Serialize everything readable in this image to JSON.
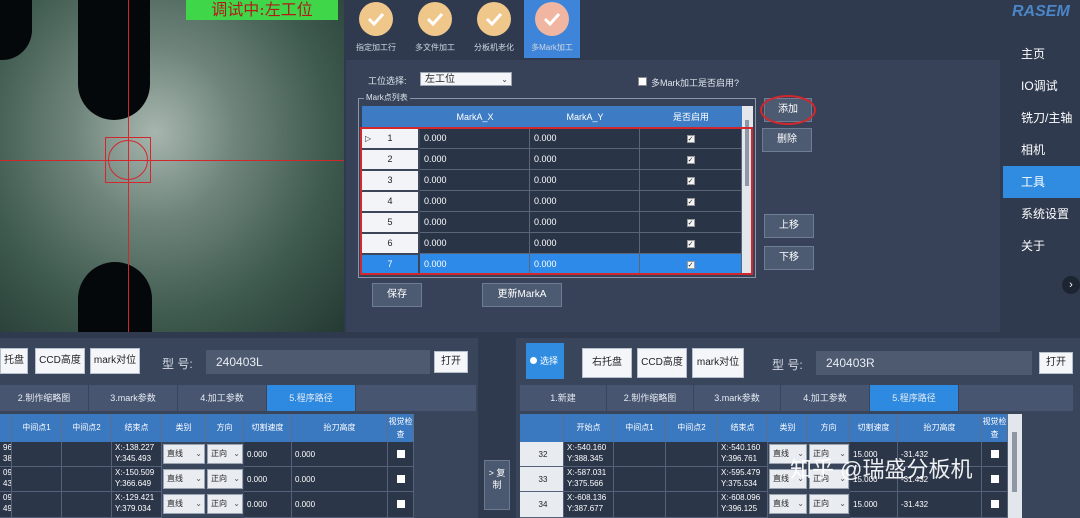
{
  "camera": {
    "status_banner": "调试中:左工位"
  },
  "toolbar": {
    "items": [
      {
        "label": "指定加工行",
        "active": false
      },
      {
        "label": "多文件加工",
        "active": false
      },
      {
        "label": "分板机老化",
        "active": false
      },
      {
        "label": "多Mark加工",
        "active": true
      }
    ]
  },
  "logo": "RASEM",
  "nav": {
    "items": [
      {
        "label": "主页",
        "active": false
      },
      {
        "label": "IO调试",
        "active": false
      },
      {
        "label": "铣刀/主轴",
        "active": false
      },
      {
        "label": "相机",
        "active": false
      },
      {
        "label": "工具",
        "active": true
      },
      {
        "label": "系统设置",
        "active": false
      },
      {
        "label": "关于",
        "active": false
      }
    ]
  },
  "mark_panel": {
    "station_label": "工位选择:",
    "station_value": "左工位",
    "enable_checkbox_label": "多Mark加工是否启用?",
    "list_group_title": "Mark点列表",
    "columns": [
      "MarkA_X",
      "MarkA_Y",
      "是否启用"
    ],
    "rows": [
      {
        "num": "1",
        "x": "0.000",
        "y": "0.000",
        "enabled": true
      },
      {
        "num": "2",
        "x": "0.000",
        "y": "0.000",
        "enabled": true
      },
      {
        "num": "3",
        "x": "0.000",
        "y": "0.000",
        "enabled": true
      },
      {
        "num": "4",
        "x": "0.000",
        "y": "0.000",
        "enabled": true
      },
      {
        "num": "5",
        "x": "0.000",
        "y": "0.000",
        "enabled": true
      },
      {
        "num": "6",
        "x": "0.000",
        "y": "0.000",
        "enabled": true
      },
      {
        "num": "7",
        "x": "0.000",
        "y": "0.000",
        "enabled": true
      }
    ],
    "buttons": {
      "add": "添加",
      "delete": "删除",
      "move_up": "上移",
      "move_down": "下移",
      "save": "保存",
      "update_mark": "更新MarkA"
    }
  },
  "left_panel": {
    "buttons": {
      "tray": "托盘",
      "ccd_height": "CCD高度",
      "mark_align": "mark对位",
      "open": "打开"
    },
    "model_label": "型  号:",
    "model_value": "240403L",
    "tabs": [
      "2.制作缩略图",
      "3.mark参数",
      "4.加工参数",
      "5.程序路径"
    ],
    "active_tab": 3,
    "columns": [
      "中间点1",
      "中间点2",
      "结束点",
      "类别",
      "方向",
      "切割速度",
      "抬刀高度",
      "视觉检查"
    ],
    "rows": [
      {
        "start": "96\n38",
        "end": "X:-138.227\nY:345.493",
        "type": "直线",
        "dir": "正向",
        "speed": "0.000",
        "lift": "0.000"
      },
      {
        "start": "09\n43",
        "end": "X:-150.509\nY:366.649",
        "type": "直线",
        "dir": "正向",
        "speed": "0.000",
        "lift": "0.000"
      },
      {
        "start": "09\n49",
        "end": "X:-129.421\nY:379.034",
        "type": "直线",
        "dir": "正向",
        "speed": "0.000",
        "lift": "0.000"
      }
    ]
  },
  "copy_button": {
    "label": "> 复制"
  },
  "right_panel": {
    "select_label": "选择",
    "buttons": {
      "tray": "右托盘",
      "ccd_height": "CCD高度",
      "mark_align": "mark对位",
      "open": "打开"
    },
    "model_label": "型  号:",
    "model_value": "240403R",
    "tabs": [
      "1.新建",
      "2.制作缩略图",
      "3.mark参数",
      "4.加工参数",
      "5.程序路径"
    ],
    "active_tab": 4,
    "columns": [
      "开始点",
      "中间点1",
      "中间点2",
      "结束点",
      "类别",
      "方向",
      "切割速度",
      "抬刀高度",
      "视觉检查"
    ],
    "rows": [
      {
        "num": "32",
        "start": "X:-540.160\nY:388.345",
        "end": "X:-540.160\nY:396.761",
        "type": "直线",
        "dir": "正向",
        "speed": "15.000",
        "lift": "-31.432"
      },
      {
        "num": "33",
        "start": "X:-587.031\nY:375.566",
        "end": "X:-595.479\nY:375.534",
        "type": "直线",
        "dir": "正向",
        "speed": "15.000",
        "lift": "-31.432"
      },
      {
        "num": "34",
        "start": "X:-608.136\nY:387.677",
        "end": "X:-608.096\nY:396.125",
        "type": "直线",
        "dir": "正向",
        "speed": "15.000",
        "lift": "-31.432"
      }
    ]
  },
  "watermark": "知乎 @瑞盛分板机",
  "colors": {
    "accent": "#2f8ce0",
    "banner": "#3fd64a",
    "highlight_red": "#d2272c"
  }
}
